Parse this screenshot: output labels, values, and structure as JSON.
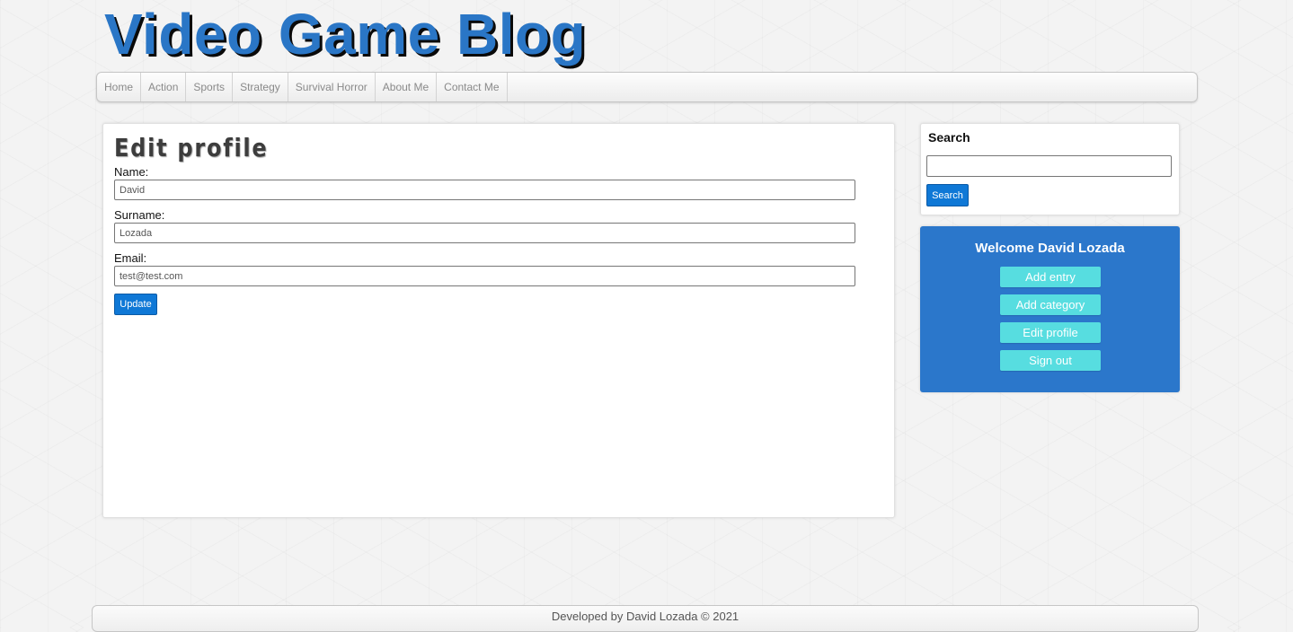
{
  "header": {
    "title": "Video Game Blog"
  },
  "nav": {
    "items": [
      "Home",
      "Action",
      "Sports",
      "Strategy",
      "Survival Horror",
      "About Me",
      "Contact Me"
    ]
  },
  "main": {
    "title": "Edit profile",
    "fields": [
      {
        "label": "Name:",
        "value": "David"
      },
      {
        "label": "Surname:",
        "value": "Lozada"
      },
      {
        "label": "Email:",
        "value": "test@test.com"
      }
    ],
    "update_label": "Update"
  },
  "search": {
    "title": "Search",
    "value": "",
    "button_label": "Search"
  },
  "user_panel": {
    "welcome": "Welcome David Lozada",
    "buttons": [
      "Add entry",
      "Add category",
      "Edit profile",
      "Sign out"
    ]
  },
  "footer": {
    "text": "Developed by David Lozada © 2021"
  },
  "colors": {
    "brand_blue": "#2a76c6",
    "panel_blue": "#2b77cb",
    "button_blue": "#0f78d6",
    "panel_button_cyan": "#57dde0"
  }
}
